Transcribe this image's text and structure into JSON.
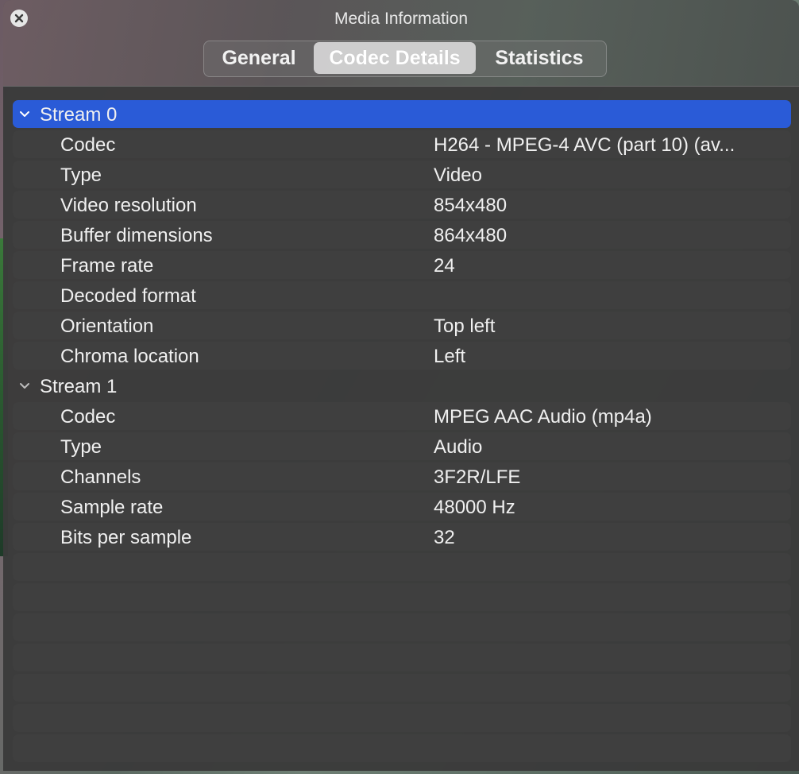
{
  "window": {
    "title": "Media Information"
  },
  "tabs": [
    {
      "label": "General"
    },
    {
      "label": "Codec Details"
    },
    {
      "label": "Statistics"
    }
  ],
  "streams": [
    {
      "label": "Stream 0",
      "rows": [
        {
          "key": "Codec",
          "value": "H264 - MPEG-4 AVC (part 10) (av..."
        },
        {
          "key": "Type",
          "value": "Video"
        },
        {
          "key": "Video resolution",
          "value": "854x480"
        },
        {
          "key": "Buffer dimensions",
          "value": "864x480"
        },
        {
          "key": "Frame rate",
          "value": "24"
        },
        {
          "key": "Decoded format",
          "value": ""
        },
        {
          "key": "Orientation",
          "value": "Top left"
        },
        {
          "key": "Chroma location",
          "value": "Left"
        }
      ]
    },
    {
      "label": "Stream 1",
      "rows": [
        {
          "key": "Codec",
          "value": "MPEG AAC Audio (mp4a)"
        },
        {
          "key": "Type",
          "value": "Audio"
        },
        {
          "key": "Channels",
          "value": "3F2R/LFE"
        },
        {
          "key": "Sample rate",
          "value": "48000 Hz"
        },
        {
          "key": "Bits per sample",
          "value": "32"
        }
      ]
    }
  ],
  "icons": {
    "close": "close-icon",
    "expand": "chevron-down-icon"
  },
  "colors": {
    "selection": "#2a5bd7",
    "row": "#3f3f3f"
  }
}
